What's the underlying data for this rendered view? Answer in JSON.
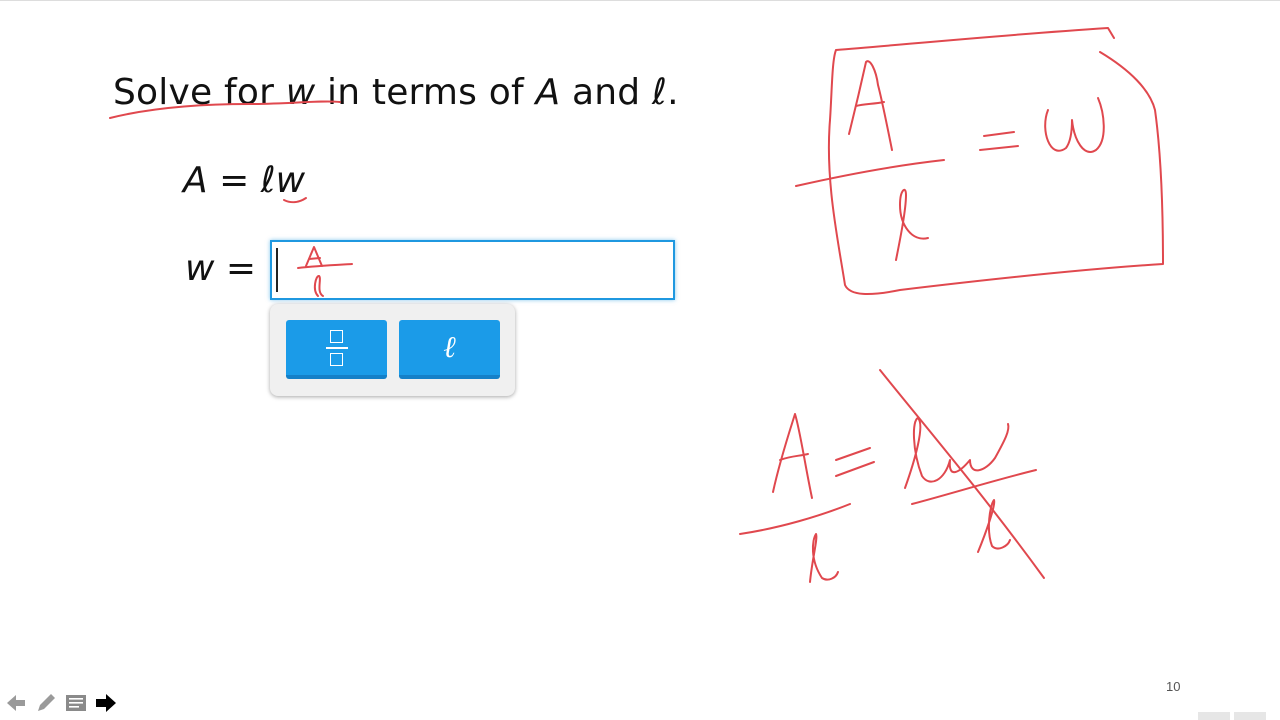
{
  "slide": {
    "title_pre": "Solve for ",
    "title_var1": "w",
    "title_mid": " in terms of ",
    "title_var2": "A",
    "title_and": " and ",
    "title_var3": "ℓ",
    "title_end": ".",
    "equation_lhs": "A",
    "equation_eq": " = ",
    "equation_rhs": "ℓw",
    "answer_var": "w",
    "answer_eq": " =",
    "answer_value": "",
    "page_number": "10"
  },
  "keypad": {
    "keys": [
      {
        "name": "fraction-key",
        "label": ""
      },
      {
        "name": "ell-key",
        "label": "ℓ"
      }
    ]
  },
  "toolbar": {
    "icons": [
      "back-arrow-icon",
      "pen-icon",
      "notes-icon",
      "forward-arrow-icon"
    ]
  },
  "colors": {
    "ink": "#e0484e",
    "key": "#1b9be8",
    "focus": "#1f98e0"
  }
}
